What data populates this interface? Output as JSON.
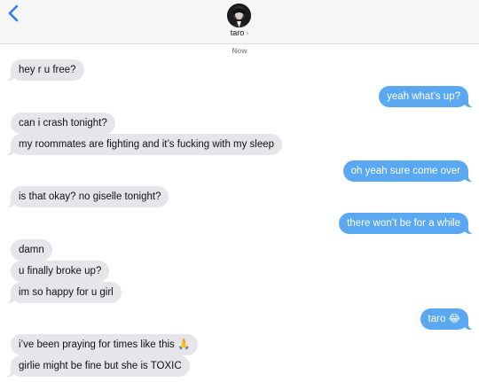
{
  "header": {
    "contact_name": "taro",
    "chevron": "›",
    "back_icon": "chevron-left-icon",
    "avatar_icon": "contact-avatar"
  },
  "thread": {
    "timestamp": "Now",
    "messages": [
      {
        "from": "them",
        "text": "hey r u free?"
      },
      {
        "from": "me",
        "text": "yeah what’s up?"
      },
      {
        "from": "them",
        "text": "can i crash tonight?"
      },
      {
        "from": "them",
        "text": "my roommates are fighting and it’s fucking with my sleep"
      },
      {
        "from": "me",
        "text": "oh yeah sure come over"
      },
      {
        "from": "them",
        "text": "is that okay? no giselle tonight?"
      },
      {
        "from": "me",
        "text": "there won’t be for a while"
      },
      {
        "from": "them",
        "text": "damn"
      },
      {
        "from": "them",
        "text": "u finally broke up?"
      },
      {
        "from": "them",
        "text": "im so happy for u girl"
      },
      {
        "from": "me",
        "text": "taro 😂"
      },
      {
        "from": "them",
        "text": "i’ve been praying for times like this 🙏"
      },
      {
        "from": "them",
        "text": "girlie might be fine but she is TOXIC"
      }
    ]
  },
  "colors": {
    "incoming_bubble": "#e5e5ea",
    "outgoing_bubble": "#5aa7f2",
    "ios_blue": "#2f7cf6"
  }
}
